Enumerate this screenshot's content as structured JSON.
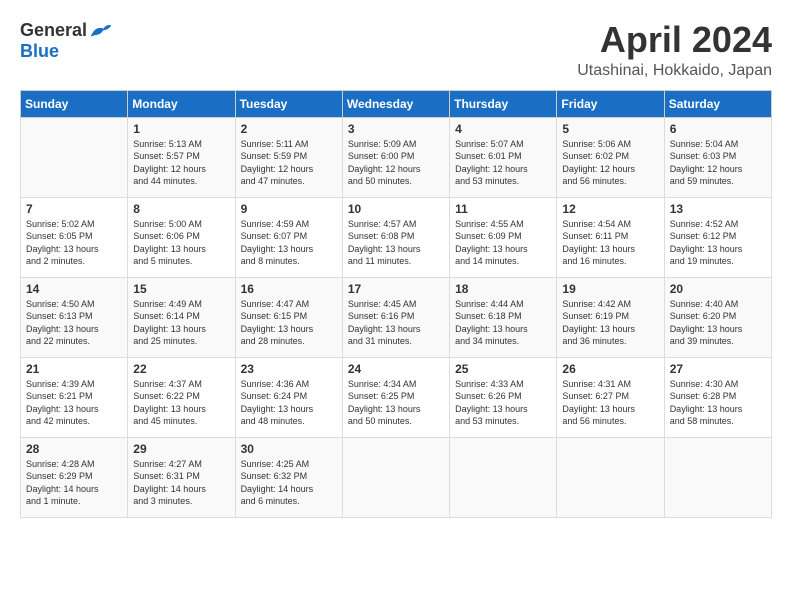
{
  "header": {
    "logo_general": "General",
    "logo_blue": "Blue",
    "month_year": "April 2024",
    "location": "Utashinai, Hokkaido, Japan"
  },
  "weekdays": [
    "Sunday",
    "Monday",
    "Tuesday",
    "Wednesday",
    "Thursday",
    "Friday",
    "Saturday"
  ],
  "weeks": [
    [
      {
        "day": "",
        "info": ""
      },
      {
        "day": "1",
        "info": "Sunrise: 5:13 AM\nSunset: 5:57 PM\nDaylight: 12 hours\nand 44 minutes."
      },
      {
        "day": "2",
        "info": "Sunrise: 5:11 AM\nSunset: 5:59 PM\nDaylight: 12 hours\nand 47 minutes."
      },
      {
        "day": "3",
        "info": "Sunrise: 5:09 AM\nSunset: 6:00 PM\nDaylight: 12 hours\nand 50 minutes."
      },
      {
        "day": "4",
        "info": "Sunrise: 5:07 AM\nSunset: 6:01 PM\nDaylight: 12 hours\nand 53 minutes."
      },
      {
        "day": "5",
        "info": "Sunrise: 5:06 AM\nSunset: 6:02 PM\nDaylight: 12 hours\nand 56 minutes."
      },
      {
        "day": "6",
        "info": "Sunrise: 5:04 AM\nSunset: 6:03 PM\nDaylight: 12 hours\nand 59 minutes."
      }
    ],
    [
      {
        "day": "7",
        "info": "Sunrise: 5:02 AM\nSunset: 6:05 PM\nDaylight: 13 hours\nand 2 minutes."
      },
      {
        "day": "8",
        "info": "Sunrise: 5:00 AM\nSunset: 6:06 PM\nDaylight: 13 hours\nand 5 minutes."
      },
      {
        "day": "9",
        "info": "Sunrise: 4:59 AM\nSunset: 6:07 PM\nDaylight: 13 hours\nand 8 minutes."
      },
      {
        "day": "10",
        "info": "Sunrise: 4:57 AM\nSunset: 6:08 PM\nDaylight: 13 hours\nand 11 minutes."
      },
      {
        "day": "11",
        "info": "Sunrise: 4:55 AM\nSunset: 6:09 PM\nDaylight: 13 hours\nand 14 minutes."
      },
      {
        "day": "12",
        "info": "Sunrise: 4:54 AM\nSunset: 6:11 PM\nDaylight: 13 hours\nand 16 minutes."
      },
      {
        "day": "13",
        "info": "Sunrise: 4:52 AM\nSunset: 6:12 PM\nDaylight: 13 hours\nand 19 minutes."
      }
    ],
    [
      {
        "day": "14",
        "info": "Sunrise: 4:50 AM\nSunset: 6:13 PM\nDaylight: 13 hours\nand 22 minutes."
      },
      {
        "day": "15",
        "info": "Sunrise: 4:49 AM\nSunset: 6:14 PM\nDaylight: 13 hours\nand 25 minutes."
      },
      {
        "day": "16",
        "info": "Sunrise: 4:47 AM\nSunset: 6:15 PM\nDaylight: 13 hours\nand 28 minutes."
      },
      {
        "day": "17",
        "info": "Sunrise: 4:45 AM\nSunset: 6:16 PM\nDaylight: 13 hours\nand 31 minutes."
      },
      {
        "day": "18",
        "info": "Sunrise: 4:44 AM\nSunset: 6:18 PM\nDaylight: 13 hours\nand 34 minutes."
      },
      {
        "day": "19",
        "info": "Sunrise: 4:42 AM\nSunset: 6:19 PM\nDaylight: 13 hours\nand 36 minutes."
      },
      {
        "day": "20",
        "info": "Sunrise: 4:40 AM\nSunset: 6:20 PM\nDaylight: 13 hours\nand 39 minutes."
      }
    ],
    [
      {
        "day": "21",
        "info": "Sunrise: 4:39 AM\nSunset: 6:21 PM\nDaylight: 13 hours\nand 42 minutes."
      },
      {
        "day": "22",
        "info": "Sunrise: 4:37 AM\nSunset: 6:22 PM\nDaylight: 13 hours\nand 45 minutes."
      },
      {
        "day": "23",
        "info": "Sunrise: 4:36 AM\nSunset: 6:24 PM\nDaylight: 13 hours\nand 48 minutes."
      },
      {
        "day": "24",
        "info": "Sunrise: 4:34 AM\nSunset: 6:25 PM\nDaylight: 13 hours\nand 50 minutes."
      },
      {
        "day": "25",
        "info": "Sunrise: 4:33 AM\nSunset: 6:26 PM\nDaylight: 13 hours\nand 53 minutes."
      },
      {
        "day": "26",
        "info": "Sunrise: 4:31 AM\nSunset: 6:27 PM\nDaylight: 13 hours\nand 56 minutes."
      },
      {
        "day": "27",
        "info": "Sunrise: 4:30 AM\nSunset: 6:28 PM\nDaylight: 13 hours\nand 58 minutes."
      }
    ],
    [
      {
        "day": "28",
        "info": "Sunrise: 4:28 AM\nSunset: 6:29 PM\nDaylight: 14 hours\nand 1 minute."
      },
      {
        "day": "29",
        "info": "Sunrise: 4:27 AM\nSunset: 6:31 PM\nDaylight: 14 hours\nand 3 minutes."
      },
      {
        "day": "30",
        "info": "Sunrise: 4:25 AM\nSunset: 6:32 PM\nDaylight: 14 hours\nand 6 minutes."
      },
      {
        "day": "",
        "info": ""
      },
      {
        "day": "",
        "info": ""
      },
      {
        "day": "",
        "info": ""
      },
      {
        "day": "",
        "info": ""
      }
    ]
  ]
}
